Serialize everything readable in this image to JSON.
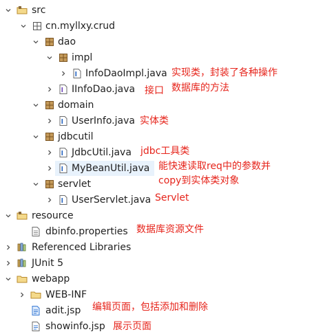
{
  "tree": [
    {
      "id": "src",
      "label": "src"
    },
    {
      "id": "pkg",
      "label": "cn.myllxy.crud"
    },
    {
      "id": "dao",
      "label": "dao"
    },
    {
      "id": "impl",
      "label": "impl"
    },
    {
      "id": "infodaoimpl",
      "label": "InfoDaoImpl.java"
    },
    {
      "id": "iinfodao",
      "label": "IInfoDao.java"
    },
    {
      "id": "domain",
      "label": "domain"
    },
    {
      "id": "userinfo",
      "label": "UserInfo.java"
    },
    {
      "id": "jdbcutil",
      "label": "jdbcutil"
    },
    {
      "id": "jdbcutiljava",
      "label": "JdbcUtil.java"
    },
    {
      "id": "mybeanutil",
      "label": "MyBeanUtil.java"
    },
    {
      "id": "servlet",
      "label": "servlet"
    },
    {
      "id": "userservlet",
      "label": "UserServlet.java"
    },
    {
      "id": "resource",
      "label": "resource"
    },
    {
      "id": "dbinfo",
      "label": "dbinfo.properties"
    },
    {
      "id": "reflibs",
      "label": "Referenced Libraries"
    },
    {
      "id": "junit",
      "label": "JUnit 5"
    },
    {
      "id": "webapp",
      "label": "webapp"
    },
    {
      "id": "webinf",
      "label": "WEB-INF"
    },
    {
      "id": "aditjsp",
      "label": "adit.jsp"
    },
    {
      "id": "showinfo",
      "label": "showinfo.jsp"
    }
  ],
  "notes": {
    "infodaoimpl_1": "实现类，封装了各种操作",
    "infodaoimpl_2": "数据库的方法",
    "iinfodao": "接口",
    "userinfo": "实体类",
    "jdbcutil": "jdbc工具类",
    "mybeanutil_1": "能快速读取req中的参数并",
    "mybeanutil_2": "copy到实体类对象",
    "userservlet": "Servlet",
    "dbinfo": "数据库资源文件",
    "aditjsp": "编辑页面，包括添加和删除",
    "showinfo": "展示页面"
  },
  "colors": {
    "annotation": "#e6241b",
    "selection": "#e8f2fc",
    "package_icon": "#a0703a",
    "folder_icon": "#d9b25c",
    "java_file_icon": "#1f5fbf"
  }
}
